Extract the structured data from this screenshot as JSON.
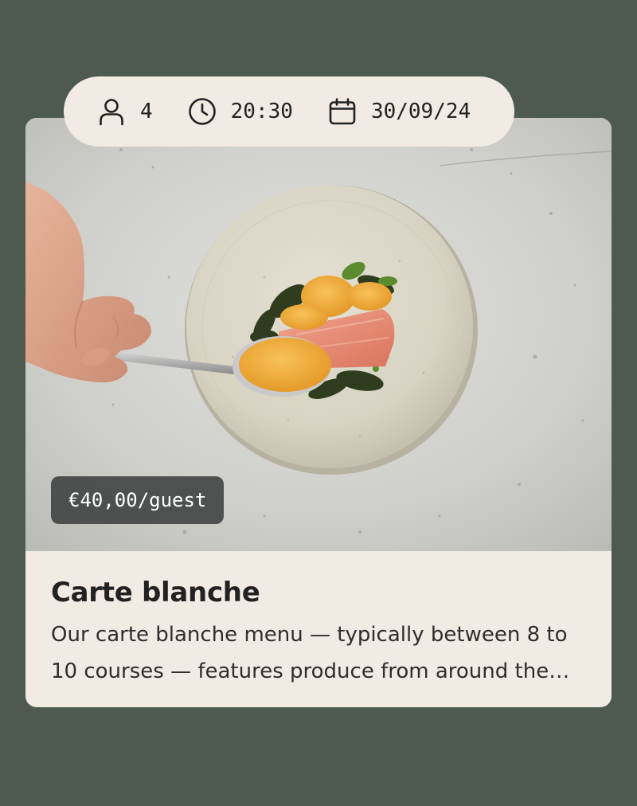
{
  "booking": {
    "guests": "4",
    "time": "20:30",
    "date": "30/09/24",
    "icons": {
      "guests": "person-icon",
      "time": "clock-icon",
      "date": "calendar-icon"
    }
  },
  "menu": {
    "price": "€40,00/guest",
    "title": "Carte blanche",
    "description": "Our carte blanche menu — typically between 8 to 10 courses — features produce from around the region."
  },
  "colors": {
    "background": "#4e5a50",
    "card": "#f1ebe4",
    "badge": "#3a3c3c",
    "text": "#232222"
  }
}
